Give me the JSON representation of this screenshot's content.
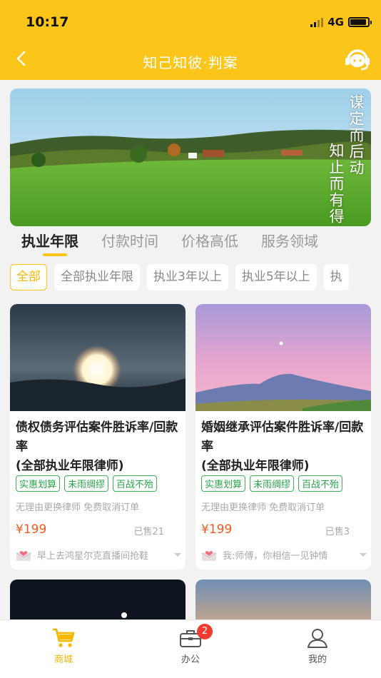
{
  "status_bar": {
    "time": "10:17",
    "network": "4G"
  },
  "nav": {
    "title": "知己知彼·判案",
    "back_icon": "chevron-left-icon",
    "service_icon": "headset-icon"
  },
  "banner": {
    "slogan_1": "谋定而后动",
    "slogan_2": "知止而有得"
  },
  "tabs": [
    {
      "label": "执业年限",
      "active": true
    },
    {
      "label": "付款时间",
      "active": false
    },
    {
      "label": "价格高低",
      "active": false
    },
    {
      "label": "服务领域",
      "active": false
    }
  ],
  "filters": [
    {
      "label": "全部",
      "active": true
    },
    {
      "label": "全部执业年限",
      "active": false
    },
    {
      "label": "执业3年以上",
      "active": false
    },
    {
      "label": "执业5年以上",
      "active": false
    },
    {
      "label": "执",
      "active": false
    }
  ],
  "products": [
    {
      "title": "债权债务评估案件胜诉率/回款率\n(全部执业年限律师)",
      "tags": [
        "实惠划算",
        "未雨绸缪",
        "百战不殆"
      ],
      "guarantee": "无理由更换律师 免费取消订单",
      "price": "¥199",
      "sold": "已售21",
      "review": "早上去鸿星尔克直播间抢鞋"
    },
    {
      "title": "婚姻继承评估案件胜诉率/回款率\n(全部执业年限律师)",
      "tags": [
        "实惠划算",
        "未雨绸缪",
        "百战不殆"
      ],
      "guarantee": "无理由更换律师 免费取消订单",
      "price": "¥199",
      "sold": "已售3",
      "review": "我:师傅，你相信一见钟情"
    }
  ],
  "tabbar": [
    {
      "label": "商城",
      "icon": "cart-icon",
      "active": true
    },
    {
      "label": "办公",
      "icon": "briefcase-icon",
      "badge": "2",
      "active": false
    },
    {
      "label": "我的",
      "icon": "user-icon",
      "active": false
    }
  ],
  "colors": {
    "brand": "#fcc51a",
    "price": "#f05a1a",
    "tag": "#2aa44a",
    "badge": "#f03c2e"
  }
}
